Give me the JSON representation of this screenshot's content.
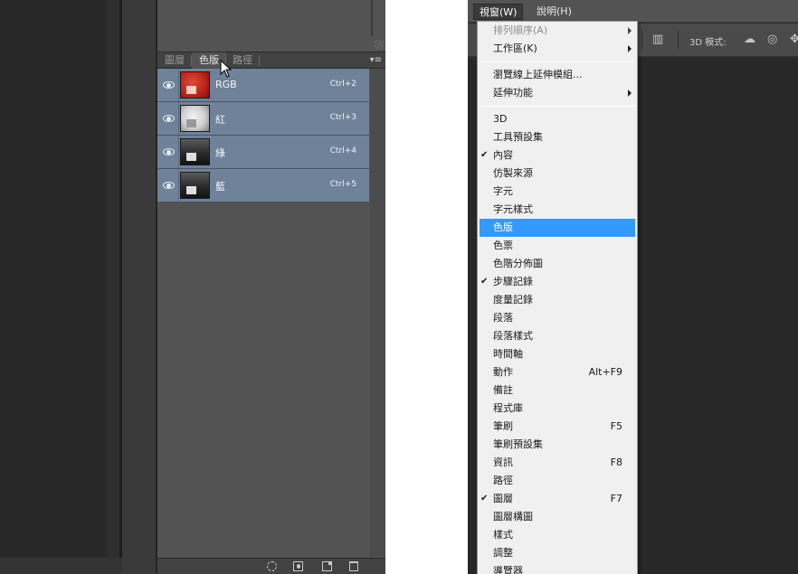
{
  "channels_panel": {
    "tabs": [
      {
        "label": "圖層",
        "active": false
      },
      {
        "label": "色版",
        "active": true
      },
      {
        "label": "路徑",
        "active": false
      }
    ],
    "panel_menu_icon": "panel-menu-icon",
    "channels": [
      {
        "name": "RGB",
        "shortcut": "Ctrl+2",
        "thumb": "rgb"
      },
      {
        "name": "紅",
        "shortcut": "Ctrl+3",
        "thumb": "red"
      },
      {
        "name": "綠",
        "shortcut": "Ctrl+4",
        "thumb": "green"
      },
      {
        "name": "藍",
        "shortcut": "Ctrl+5",
        "thumb": "blue"
      }
    ],
    "footer_icons": [
      "load-selection-icon",
      "save-selection-icon",
      "new-channel-icon",
      "delete-channel-icon"
    ],
    "selection_color": "#6f8299"
  },
  "app_menu": {
    "menubar": [
      {
        "label": "視窗(W)",
        "open": true
      },
      {
        "label": "說明(H)",
        "open": false
      }
    ],
    "options_bar": {
      "mode_label": "3D 模式:"
    },
    "window_menu": [
      {
        "label": "排列順序(A)",
        "disabled": true,
        "submenu": true
      },
      {
        "label": "工作區(K)",
        "submenu": true
      },
      {
        "separator": true
      },
      {
        "label": "瀏覽線上延伸模組..."
      },
      {
        "label": "延伸功能",
        "submenu": true
      },
      {
        "separator": true
      },
      {
        "label": "3D"
      },
      {
        "label": "工具預設集"
      },
      {
        "label": "內容",
        "checked": true
      },
      {
        "label": "仿製來源"
      },
      {
        "label": "字元"
      },
      {
        "label": "字元樣式"
      },
      {
        "label": "色版",
        "highlighted": true
      },
      {
        "label": "色票"
      },
      {
        "label": "色階分佈圖"
      },
      {
        "label": "步驟記錄",
        "checked": true
      },
      {
        "label": "度量記錄"
      },
      {
        "label": "段落"
      },
      {
        "label": "段落樣式"
      },
      {
        "label": "時間軸"
      },
      {
        "label": "動作",
        "shortcut": "Alt+F9"
      },
      {
        "label": "備註"
      },
      {
        "label": "程式庫"
      },
      {
        "label": "筆刷",
        "shortcut": "F5"
      },
      {
        "label": "筆刷預設集"
      },
      {
        "label": "資訊",
        "shortcut": "F8"
      },
      {
        "label": "路徑"
      },
      {
        "label": "圖層",
        "checked": true,
        "shortcut": "F7"
      },
      {
        "label": "圖層構圖"
      },
      {
        "label": "樣式"
      },
      {
        "label": "調整"
      },
      {
        "label": "導覽器"
      }
    ],
    "highlight_color": "#3399ff"
  }
}
